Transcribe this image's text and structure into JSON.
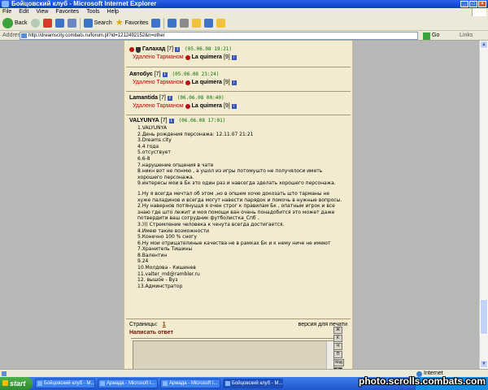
{
  "window": {
    "title": "Бойцовский клуб - Microsoft Internet Explorer"
  },
  "menu": [
    "File",
    "Edit",
    "View",
    "Favorites",
    "Tools",
    "Help"
  ],
  "toolbar": {
    "back_label": "Back",
    "search_label": "Search",
    "favorites_label": "Favorites"
  },
  "address": {
    "label": "Address",
    "url": "http://dreamscity.combats.ru/forum.pl?id=1212492152&n=other",
    "go_label": "Go",
    "links_label": "Links"
  },
  "posts": [
    {
      "author": "Галахад",
      "level": "[7]",
      "date": "(05.06.08 19:21)",
      "deleted_text": "Удалено Тарманом",
      "moderator": "La quimera",
      "moderator_level": "[9]"
    },
    {
      "author": "Автобус",
      "level": "[7]",
      "date": "(05.06.08 23:24)",
      "deleted_text": "Удалено Тарманом",
      "moderator": "La quimera",
      "moderator_level": "[9]"
    },
    {
      "author": "Lamantida",
      "level": "[7]",
      "date": "(06.06.08 00:40)",
      "deleted_text": "Удалено Тарманом",
      "moderator": "La quimera",
      "moderator_level": "[9]"
    }
  ],
  "main_post": {
    "author": "VALYUNYA",
    "level": "[7]",
    "date": "(06.06.08 17:01)",
    "lines": [
      "1.VALYUNYA",
      "2.День рождения персонажа: 12.11.07 21:21",
      "3.Dreams city",
      "4.4 года",
      "5.отсуствует",
      "6.6-8",
      "7.нарушение опщения в чате",
      "8.никн вот не понмю , а ушол из игры потомушто не получялоси иметь",
      "хорошего персонажа.",
      "9.интересы мои в Бк это один раз и навсегда зделать хорошего персонажа.",
      "",
      "1.Ну я всегда мечтал об этом ,но в опшем хочю докозать што тарманы не",
      "хуже паладинов и всегда могут навести парядок и помочь в нужные вопросы.",
      "2.Ну навернов потянуцця я очен строг к правилам Бк , опатным игрок и все",
      "знаю где што лежит и моя помощи ван очень понадобится это может даже",
      "потвердити ваш сотрудник футболистка_Спб .",
      "3.))) Стремление человека к ченута всегда достигается.",
      "4.Имею такие возможности",
      "5.Конечно 100 % сногу",
      "6.Ну мои отрицателиные качества не в рамках Бк и к нему ниче не имеют",
      "7.Хранитель Тишины",
      "8.Валентин",
      "9.24",
      "10.Молдова - Кишинев",
      "11.valter_md@rambler.ru",
      "12. вышое   - Вуз",
      "13.Админстратор"
    ]
  },
  "pages": {
    "label": "Страницы:",
    "current": "1",
    "print_label": "версия для печати"
  },
  "reply": {
    "title": "Написать ответ",
    "buttons": [
      "Ж",
      "К",
      "Ч",
      "П",
      "Код",
      "Б"
    ]
  },
  "status": {
    "zone": "Internet"
  },
  "taskbar": {
    "start": "start",
    "tasks": [
      "Бойцовский клуб - М...",
      "Армада - Microsoft I...",
      "Армада - Microsoft I...",
      "Бойцовский клуб - М..."
    ]
  },
  "watermark": "photo.scrolls.combats.com"
}
